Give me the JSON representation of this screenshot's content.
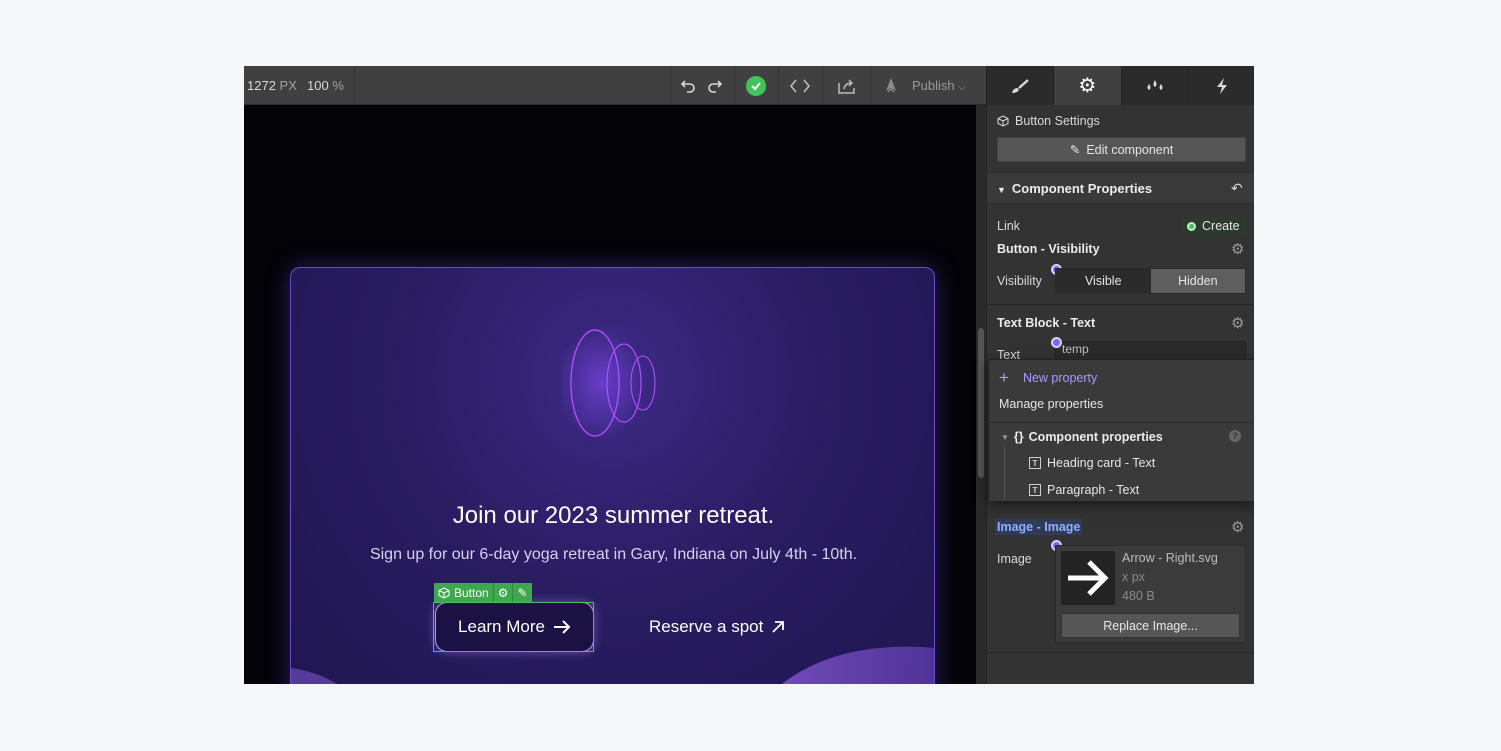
{
  "topbar": {
    "width_value": "1272",
    "width_unit": "PX",
    "zoom_value": "100",
    "zoom_unit": "%",
    "publish_label": "Publish"
  },
  "canvas": {
    "card_title": "Join our 2023 summer retreat.",
    "card_subtitle": "Sign up for our 6-day yoga retreat in Gary, Indiana on July 4th - 10th.",
    "selection_tag": "Button",
    "primary_button": "Learn More",
    "secondary_link": "Reserve a spot"
  },
  "panel": {
    "tabs": [
      "style",
      "settings",
      "interactions",
      "lightning"
    ],
    "settings_title": "Button Settings",
    "edit_component": "Edit component",
    "component_properties": "Component Properties",
    "link_label": "Link",
    "create_label": "Create",
    "visibility_group": "Button - Visibility",
    "visibility_label": "Visibility",
    "visible_option": "Visible",
    "hidden_option": "Hidden",
    "text_group": "Text Block - Text",
    "text_label": "Text",
    "text_value": "temp",
    "image_group": "Image - Image",
    "image_label": "Image",
    "image_file": "Arrow - Right.svg",
    "image_dims": "x px",
    "image_size": "480 B",
    "replace_label": "Replace Image..."
  },
  "dropdown": {
    "new_property": "New property",
    "manage_properties": "Manage properties",
    "group_label": "Component properties",
    "items": [
      "Heading card - Text",
      "Paragraph - Text"
    ]
  },
  "colors": {
    "accent_green": "#3fc45b",
    "accent_purple": "#7b66ff",
    "card_border": "#6a4bd0"
  }
}
